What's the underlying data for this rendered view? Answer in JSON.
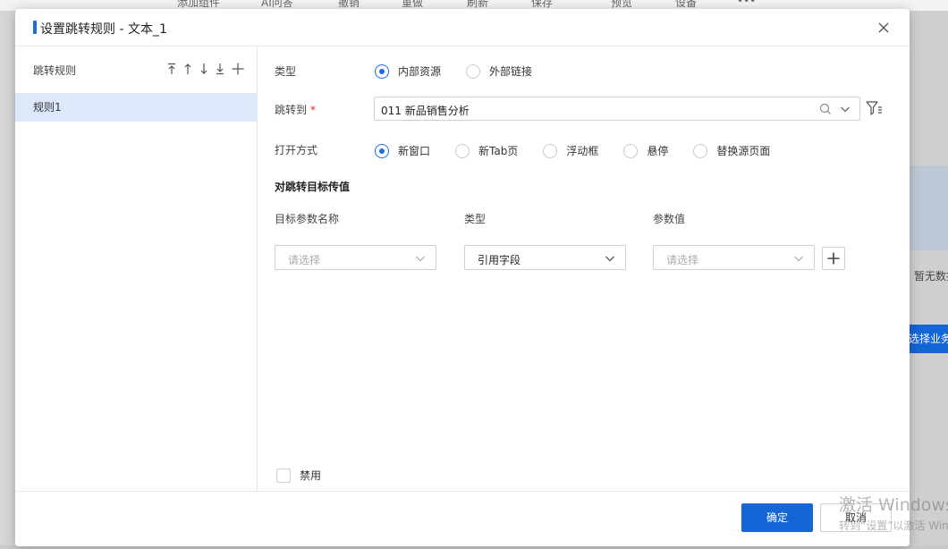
{
  "background": {
    "toolbar_items": [
      "添加组件",
      "AI问答",
      "撤销",
      "重做",
      "刷新",
      "保存",
      "预览",
      "设备",
      "•••"
    ],
    "empty_text": "暂无数据",
    "select_business_button": "选择业务数据"
  },
  "dialog": {
    "title": "设置跳转规则 - 文本_1",
    "accent_color": "#1a6fe0"
  },
  "rules_panel": {
    "title": "跳转规则",
    "tools": [
      "move-top-icon",
      "move-up-icon",
      "move-down-icon",
      "move-bottom-icon",
      "add-icon"
    ],
    "items": [
      {
        "label": "规则1",
        "selected": true
      }
    ]
  },
  "form": {
    "type": {
      "label": "类型",
      "options": [
        {
          "label": "内部资源",
          "checked": true
        },
        {
          "label": "外部链接",
          "checked": false
        }
      ]
    },
    "jump_to": {
      "label": "跳转到",
      "required_mark": "*",
      "value": "011 新品销售分析"
    },
    "open_mode": {
      "label": "打开方式",
      "options": [
        {
          "label": "新窗口",
          "checked": true
        },
        {
          "label": "新Tab页",
          "checked": false
        },
        {
          "label": "浮动框",
          "checked": false
        },
        {
          "label": "悬停",
          "checked": false
        },
        {
          "label": "替换源页面",
          "checked": false
        }
      ]
    },
    "params": {
      "section_title": "对跳转目标传值",
      "columns": [
        "目标参数名称",
        "类型",
        "参数值"
      ],
      "target_param_placeholder": "请选择",
      "type_value": "引用字段",
      "param_value_placeholder": "请选择"
    },
    "disable_label": "禁用",
    "disabled": false
  },
  "footer": {
    "ok_label": "确定",
    "cancel_label": "取消"
  },
  "watermark": {
    "line1": "激活 Windows",
    "line2": "转到“设置”以激活 Windows。"
  }
}
